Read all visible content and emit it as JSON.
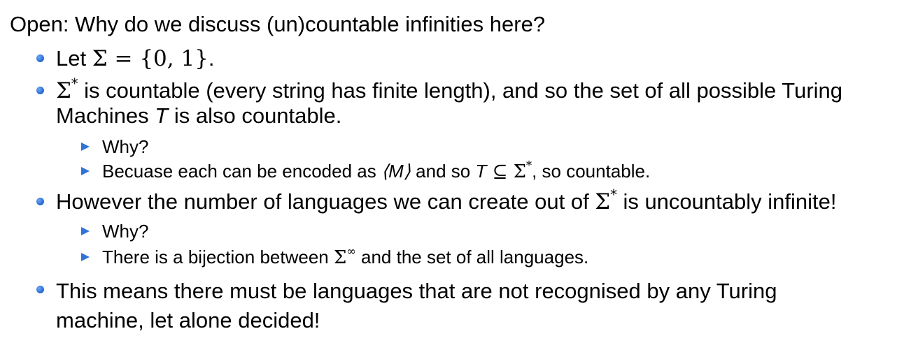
{
  "title": "Open: Why do we discuss (un)countable infinities here?",
  "bullets": [
    {
      "prefix": "Let ",
      "math": "Σ = {0, 1}",
      "suffix": "."
    },
    {
      "sigma": "Σ",
      "star": "*",
      "text1": " is countable (every string has finite length), and so the set of all possible Turing",
      "text2": "Machines ",
      "T": "T",
      "text3": " is also countable.",
      "subs": [
        {
          "text": "Why?"
        },
        {
          "prefix": "Becuase each can be encoded as ",
          "enc": "⟨M⟩",
          "mid": " and so ",
          "T": "T",
          "sub_rel": " ⊆ Σ",
          "star": "*",
          "suffix": ", so countable."
        }
      ]
    },
    {
      "text1": "However the number of languages we can create out of ",
      "sigma": "Σ",
      "star": "*",
      "text2": " is uncountably infinite!",
      "subs": [
        {
          "text": "Why?"
        },
        {
          "prefix": "There is a bijection between ",
          "sigma": "Σ",
          "inf": "∞",
          "suffix": " and the set of all languages."
        }
      ]
    },
    {
      "line1": "This means there must be languages that are not recognised by any Turing",
      "line2": "machine, let alone decided!"
    }
  ],
  "colors": {
    "bullet": "#2f73d8",
    "text": "#000000",
    "background": "#ffffff"
  }
}
